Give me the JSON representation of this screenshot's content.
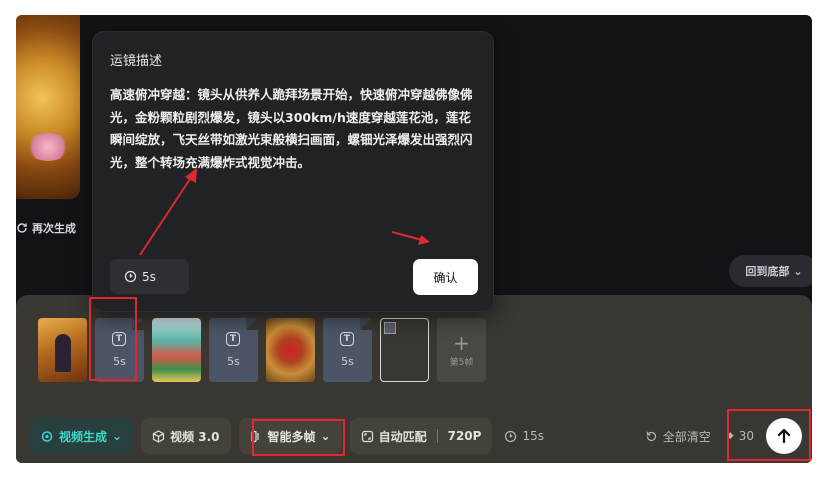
{
  "canvas": {
    "regenerate_label": "再次生成",
    "back_to_bottom_label": "回到底部"
  },
  "popover": {
    "title": "运镜描述",
    "description": "高速俯冲穿越：镜头从供养人跪拜场景开始，快速俯冲穿越佛像佛光，金粉颗粒剧烈爆发，镜头以300km/h速度穿越莲花池，莲花瞬间绽放，飞天丝带如激光束般横扫画面，螺钿光泽爆发出强烈闪光，整个转场充满爆炸式视觉冲击。",
    "duration": "5s",
    "confirm_label": "确认"
  },
  "frames": {
    "transition_1": "5s",
    "transition_2": "5s",
    "transition_3": "5s",
    "add_label": "第5帧"
  },
  "toolbar": {
    "mode_label": "视频生成",
    "model_label": "视频 3.0",
    "multiframe_label": "智能多帧",
    "ratio_label": "自动匹配",
    "resolution_label": "720P",
    "duration_label": "15s",
    "clear_label": "全部清空",
    "credits": "30"
  },
  "colors": {
    "accent": "#3fd7c6",
    "annotation_red": "#e0282e",
    "panel_bg": "#3a3732"
  }
}
